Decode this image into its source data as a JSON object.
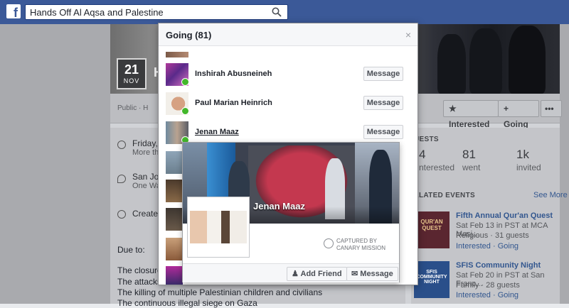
{
  "topbar": {
    "logo": "f",
    "search_value": "Hands Off Al Aqsa and Palestine",
    "search_icon": "search-icon"
  },
  "event": {
    "date_day": "21",
    "date_month": "NOV",
    "title_partial": "H",
    "public_row": "Public · H",
    "buttons": {
      "interested": "Interested",
      "going": "Going",
      "more": "•••"
    }
  },
  "details": {
    "date_line": "Friday,",
    "date_sub": "More th",
    "place_line": "San Jo",
    "place_sub": "One Wa",
    "created": "Create"
  },
  "description": {
    "intro": "Due to:",
    "lines": [
      "The closure",
      "The attacks",
      "The killing of multiple Palestinian children and civilians",
      "The continuous illegal siege on Gaza"
    ]
  },
  "guests": {
    "heading": "UESTS",
    "stats": [
      {
        "number": "4",
        "label": "nterested"
      },
      {
        "number": "81",
        "label": "went"
      },
      {
        "number": "1k",
        "label": "invited"
      }
    ]
  },
  "related": {
    "heading": "ELATED EVENTS",
    "see_more": "See More",
    "items": [
      {
        "thumb_text": "QUR'AN QUEST",
        "title": "Fifth Annual Qur'an Quest",
        "when": "Sat Feb 13 in PST at MCA Masj...",
        "meta": "Religious · 31 guests",
        "actions": "Interested · Going"
      },
      {
        "thumb_text": "SFIS COMMUNITY NIGHT",
        "title": "SFIS Community Night",
        "when": "Sat Feb 20 in PST at San Franc...",
        "meta": "Family · 28 guests",
        "actions": "Interested · Going"
      }
    ]
  },
  "modal": {
    "title": "Going (81)",
    "close": "×",
    "people": [
      {
        "name": "Inshirah Abusneineh",
        "button": "Message"
      },
      {
        "name": "Paul Marian Heinrich",
        "button": "Message"
      },
      {
        "name": "Jenan Maaz",
        "button": "Message"
      }
    ]
  },
  "hovercard": {
    "name": "Jenan Maaz",
    "caption_line1": "CAPTURED BY",
    "caption_line2": "CANARY MISSION",
    "add_friend": "Add Friend",
    "message": "Message"
  },
  "colors": {
    "brand": "#3b5998",
    "link": "#365899",
    "check": "#42b72a"
  }
}
